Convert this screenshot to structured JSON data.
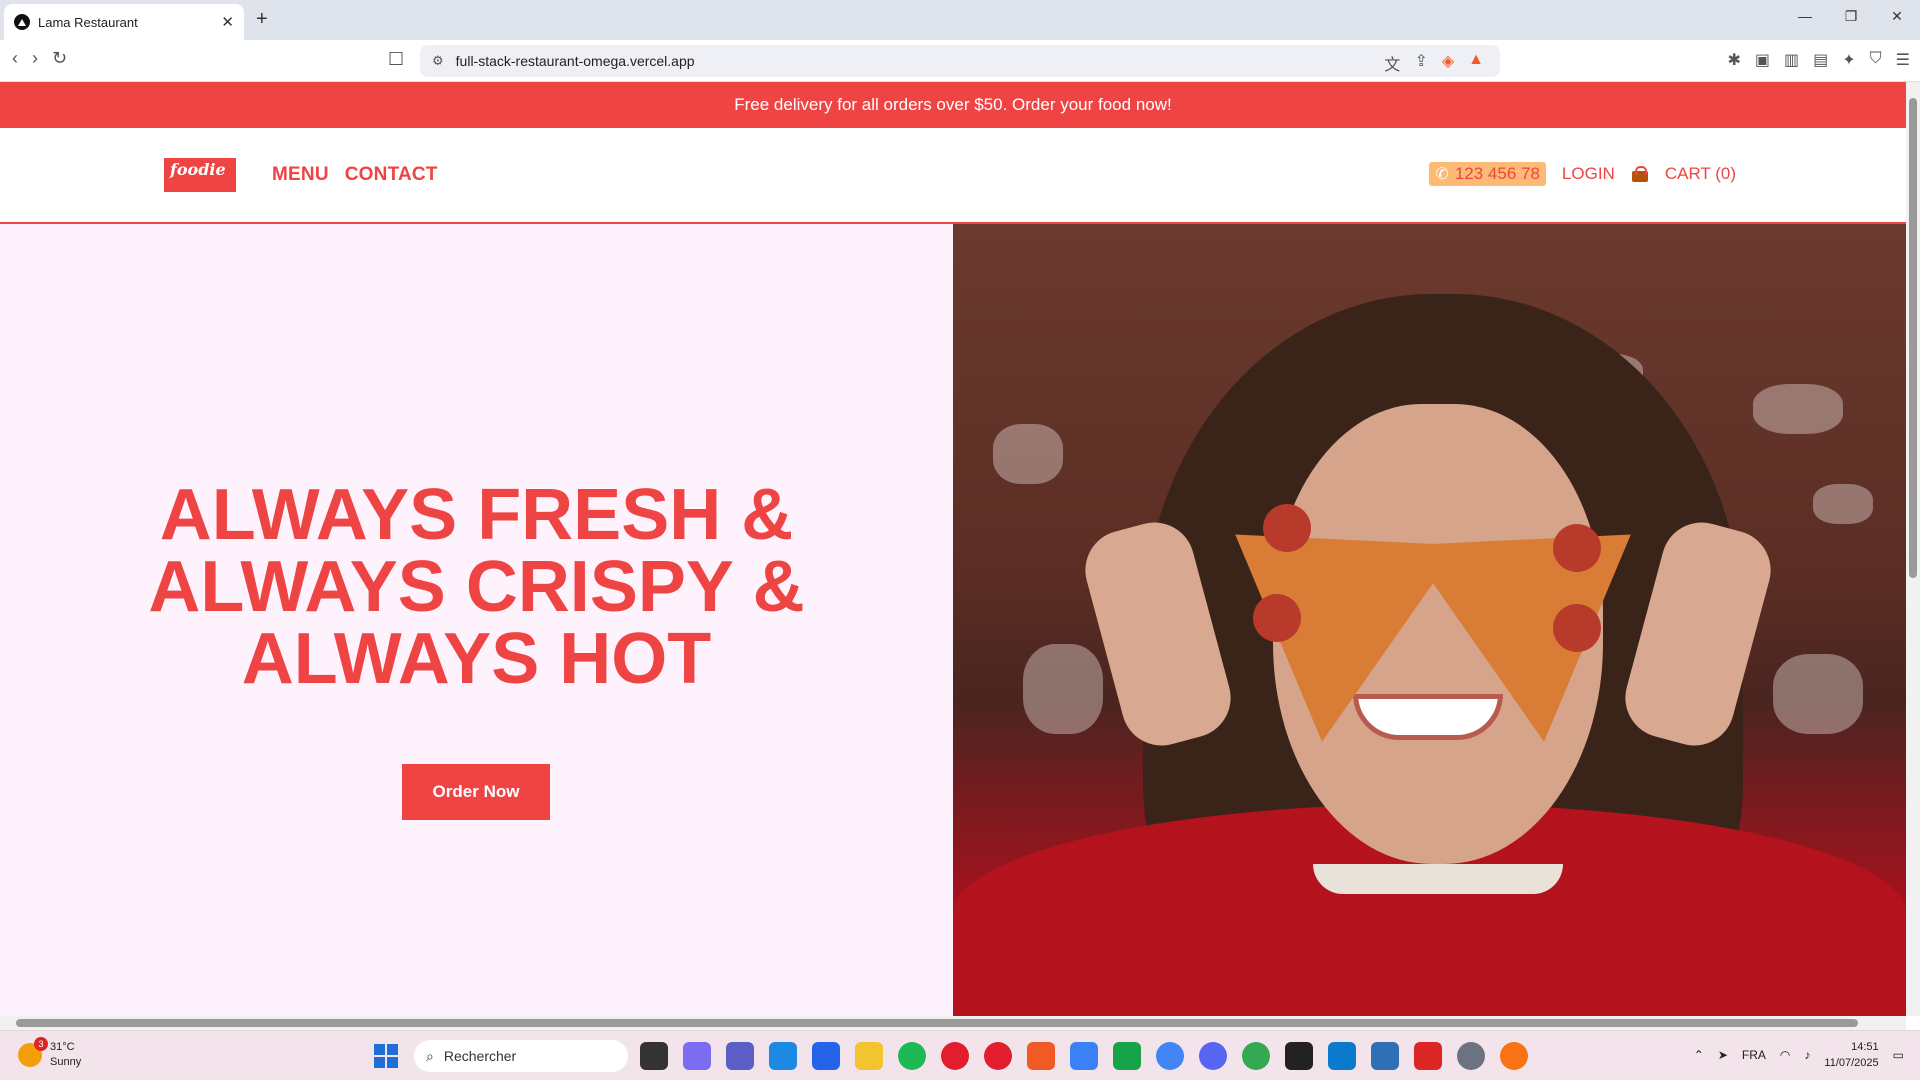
{
  "browser": {
    "tab_title": "Lama Restaurant",
    "tab_close": "✕",
    "new_tab": "+",
    "window_controls": [
      "—",
      "❐",
      "✕"
    ],
    "nav": [
      "‹",
      "›",
      "↻"
    ],
    "url": "full-stack-restaurant-omega.vercel.app"
  },
  "promo": {
    "text": "Free delivery for all orders over $50. Order your food now!"
  },
  "header": {
    "logo": "foodie",
    "nav": [
      "MENU",
      "CONTACT"
    ],
    "phone": "123 456 78",
    "login": "LOGIN",
    "cart": "CART (0)"
  },
  "hero": {
    "headline_lines": [
      "ALWAYS FRESH &",
      "ALWAYS CRISPY &",
      "ALWAYS HOT"
    ],
    "cta": "Order Now"
  },
  "taskbar": {
    "weather_temp": "31°C",
    "weather_desc": "Sunny",
    "weather_badge": "3",
    "search_placeholder": "Rechercher",
    "language": "FRA",
    "time": "14:51",
    "date": "11/07/2025"
  },
  "colors": {
    "accent": "#ef4444",
    "hero_bg": "#fef3fc",
    "phone_bg": "#fdba74"
  }
}
